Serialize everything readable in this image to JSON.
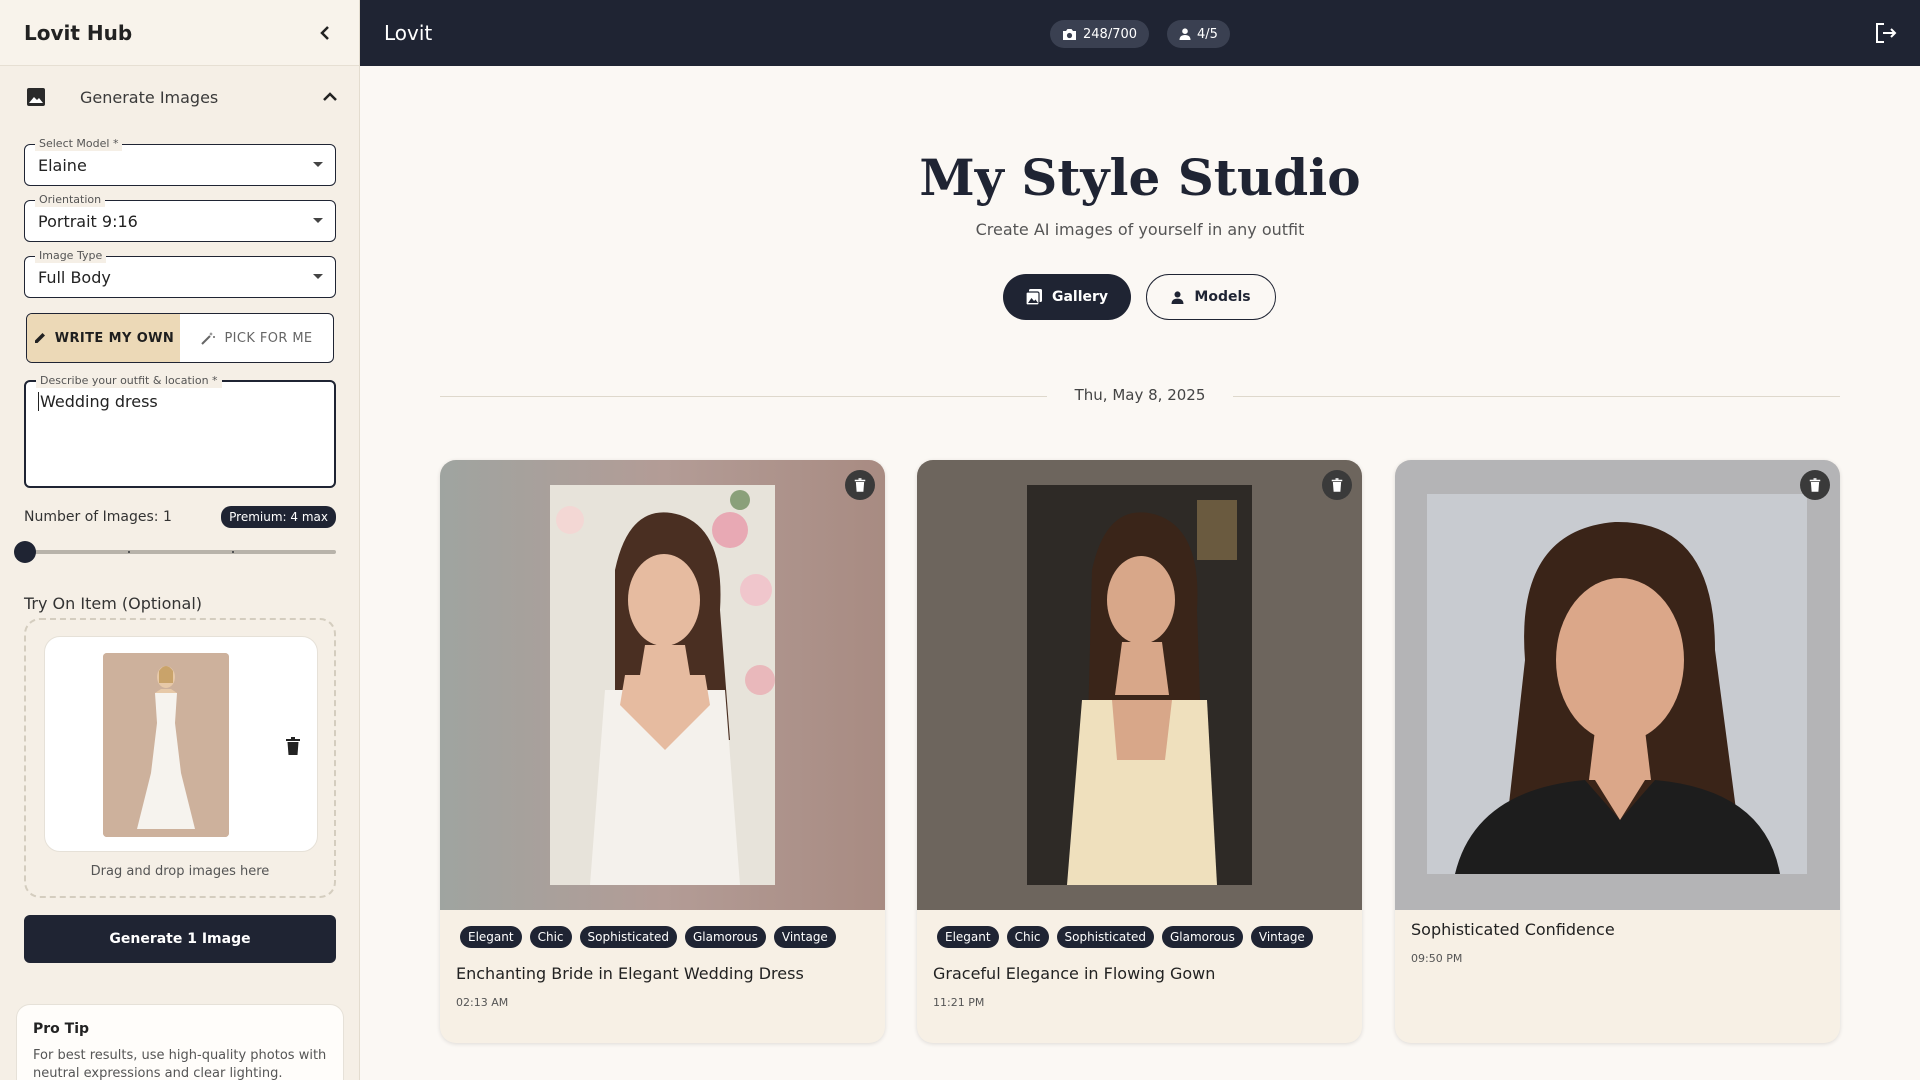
{
  "sidebar": {
    "title": "Lovit Hub",
    "section_label": "Generate Images",
    "model_field": {
      "legend": "Select Model *",
      "value": "Elaine"
    },
    "orientation_field": {
      "legend": "Orientation",
      "value": "Portrait 9:16"
    },
    "image_type_field": {
      "legend": "Image Type",
      "value": "Full Body"
    },
    "mode_toggle": {
      "write_label": "WRITE MY OWN",
      "pick_label": "PICK FOR ME",
      "active": "write"
    },
    "description_field": {
      "legend": "Describe your outfit & location *",
      "value": "Wedding dress"
    },
    "number_of_images": {
      "label": "Number of Images: 1",
      "value": 1,
      "max": 4,
      "premium_badge": "Premium: 4 max"
    },
    "try_on": {
      "label": "Try On Item (Optional)",
      "drop_text": "Drag and drop images here"
    },
    "generate_button": "Generate 1 Image",
    "pro_tip": {
      "title": "Pro Tip",
      "text": "For best results, use high-quality photos with neutral expressions and clear lighting."
    }
  },
  "topbar": {
    "title": "Lovit",
    "photo_count": "248/700",
    "model_count": "4/5",
    "colors": {
      "bar": "#1f2433",
      "chip": "#3a4051"
    }
  },
  "main": {
    "title": "My Style Studio",
    "subtitle": "Create AI images of yourself in any outfit",
    "gallery_button": "Gallery",
    "models_button": "Models",
    "date": "Thu, May 8, 2025",
    "cards": [
      {
        "tags": [
          "Elegant",
          "Chic",
          "Sophisticated",
          "Glamorous",
          "Vintage"
        ],
        "title": "Enchanting Bride in Elegant Wedding Dress",
        "time": "02:13 AM"
      },
      {
        "tags": [
          "Elegant",
          "Chic",
          "Sophisticated",
          "Glamorous",
          "Vintage"
        ],
        "title": "Graceful Elegance in Flowing Gown",
        "time": "11:21 PM"
      },
      {
        "tags": [],
        "title": "Sophisticated Confidence",
        "time": "09:50 PM"
      }
    ]
  },
  "icons": {
    "collapse": "chevron-left-icon",
    "section": "image-icon",
    "expand": "chevron-up-icon",
    "pencil": "pencil-icon",
    "wand": "magic-wand-icon",
    "trash": "trash-icon",
    "camera": "camera-icon",
    "person": "person-icon",
    "gallery": "gallery-icon",
    "logout": "logout-icon"
  }
}
